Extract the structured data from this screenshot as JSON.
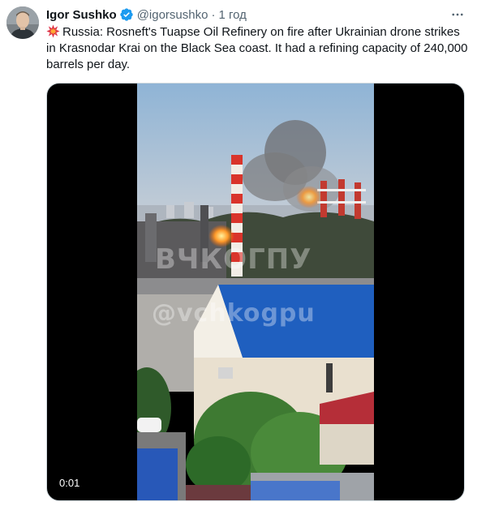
{
  "tweet": {
    "author": {
      "name": "Igor Sushko",
      "handle": "@igorsushko",
      "verified_icon": "verified-badge-icon",
      "avatar_icon": "avatar"
    },
    "separator": "·",
    "time": "1 год",
    "text": "Russia: Rosneft's Tuapse Oil Refinery on fire after Ukrainian drone strikes in Krasnodar Krai on the Black Sea coast. It had a refining capacity of 240,000 barrels per day.",
    "leading_emoji": "collision-icon",
    "more_icon": "more-icon"
  },
  "media": {
    "type": "video",
    "timestamp": "0:01",
    "watermark_top": "ВЧКОГПУ",
    "watermark_mid": "@vchkogpu"
  },
  "colors": {
    "text_primary": "#0f1419",
    "text_secondary": "#536471",
    "verified": "#1d9bf0",
    "roof_blue": "#1f5fbf"
  }
}
